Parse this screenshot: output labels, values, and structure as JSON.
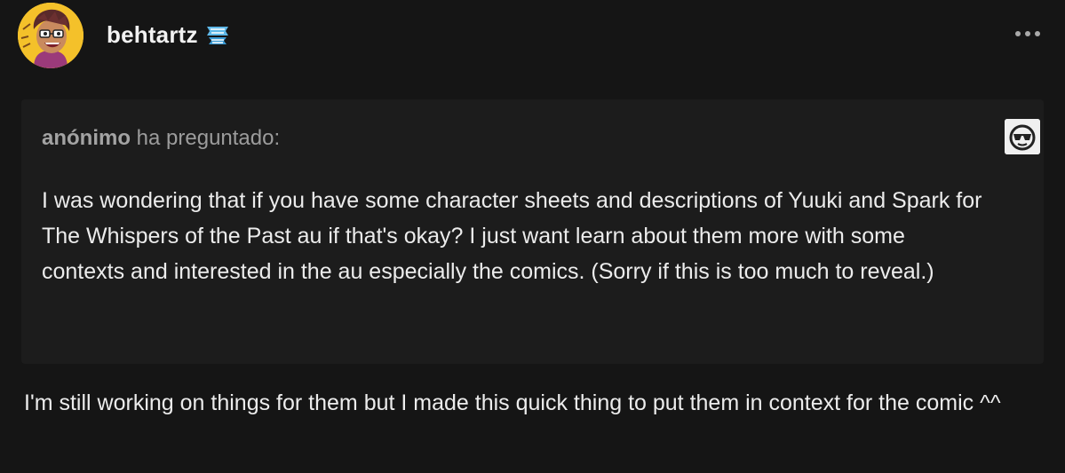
{
  "post": {
    "blog_name": "behtartz",
    "badge_icon": "blue-ribbon-badge-icon",
    "more_icon": "ellipsis-icon",
    "ask": {
      "asker": "anónimo",
      "asked_suffix": "ha preguntado:",
      "asker_icon": "sunglasses-face-icon",
      "question": "I was wondering that if you have some character sheets and descriptions of Yuuki and Spark for The Whispers of the Past au if that's okay? I just want learn about them more with some contexts and interested in the au especially the comics. (Sorry if this is too much to reveal.)"
    },
    "answer": "I'm still working on things for them but I made this quick thing to put them in context for the comic ^^"
  },
  "colors": {
    "background": "#151515",
    "ask_box": "#1c1c1c",
    "text": "#ececec",
    "muted": "#9c9c9c",
    "avatar_bg": "#f4c12a"
  }
}
